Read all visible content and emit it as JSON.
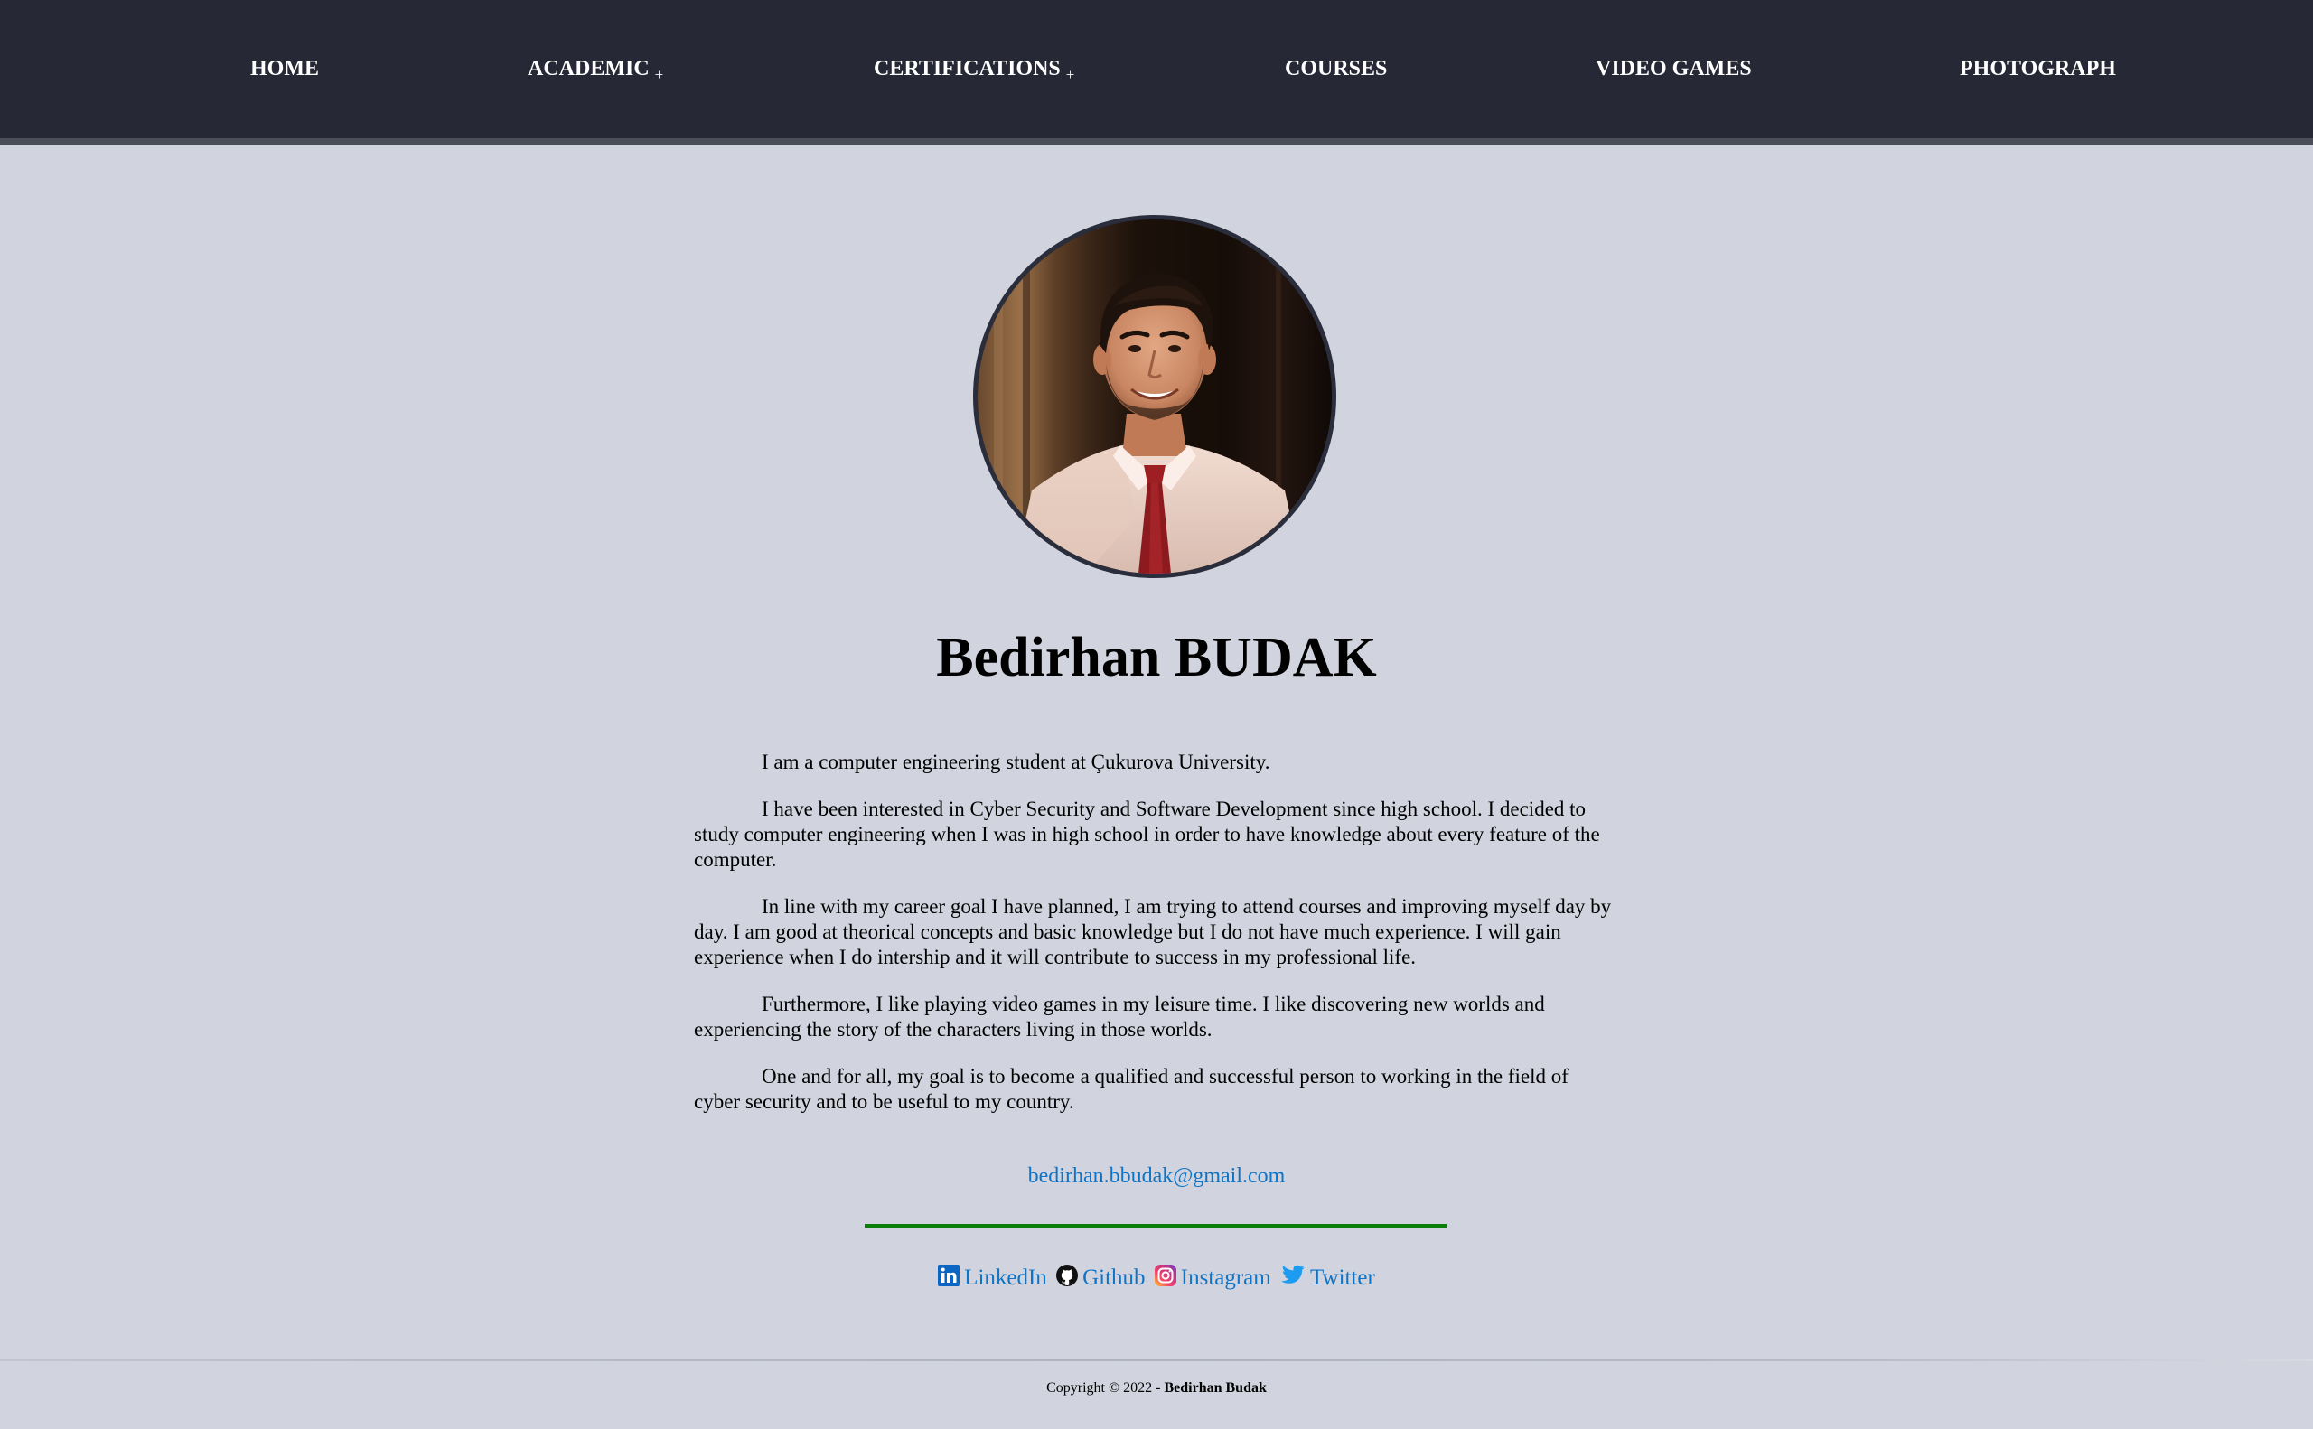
{
  "nav": {
    "items": [
      {
        "label": "HOME",
        "has_submenu": false
      },
      {
        "label": "ACADEMIC",
        "has_submenu": true
      },
      {
        "label": "CERTIFICATIONS",
        "has_submenu": true
      },
      {
        "label": "COURSES",
        "has_submenu": false
      },
      {
        "label": "VIDEO GAMES",
        "has_submenu": false
      },
      {
        "label": "PHOTOGRAPH",
        "has_submenu": false
      }
    ],
    "submenu_marker": "+"
  },
  "profile": {
    "name": "Bedirhan BUDAK",
    "avatar_icon": "profile-photo"
  },
  "bio": {
    "paragraphs": [
      "I am a computer engineering student at Çukurova University.",
      "I have been interested in Cyber Security and Software Development since high school. I decided to study computer engineering when I was in high school in order to have knowledge about every feature of the computer.",
      "In line with my career goal I have planned, I am trying to attend courses and improving myself day by day. I am good at theorical concepts and basic knowledge but I do not have much experience. I will gain experience when I do intership and it will contribute to success in my professional life.",
      "Furthermore, I like playing video games in my leisure time. I like discovering new worlds and experiencing the story of the characters living in those worlds.",
      "One and for all, my goal is to become a qualified and successful person to working in the field of cyber security and to be useful to my country."
    ]
  },
  "contact": {
    "email": "bedirhan.bbudak@gmail.com"
  },
  "socials": [
    {
      "label": "LinkedIn",
      "icon": "linkedin-icon"
    },
    {
      "label": "Github",
      "icon": "github-icon"
    },
    {
      "label": "Instagram",
      "icon": "instagram-icon"
    },
    {
      "label": "Twitter",
      "icon": "twitter-icon"
    }
  ],
  "footer": {
    "copyright_prefix": "Copyright © 2022 - ",
    "author": "Bedirhan Budak"
  },
  "colors": {
    "nav_bg": "#262835",
    "page_bg": "#d1d4de",
    "link": "#0f74c6",
    "divider": "#0a800a",
    "linkedin": "#0a66c2",
    "twitter": "#1d9bf0"
  }
}
